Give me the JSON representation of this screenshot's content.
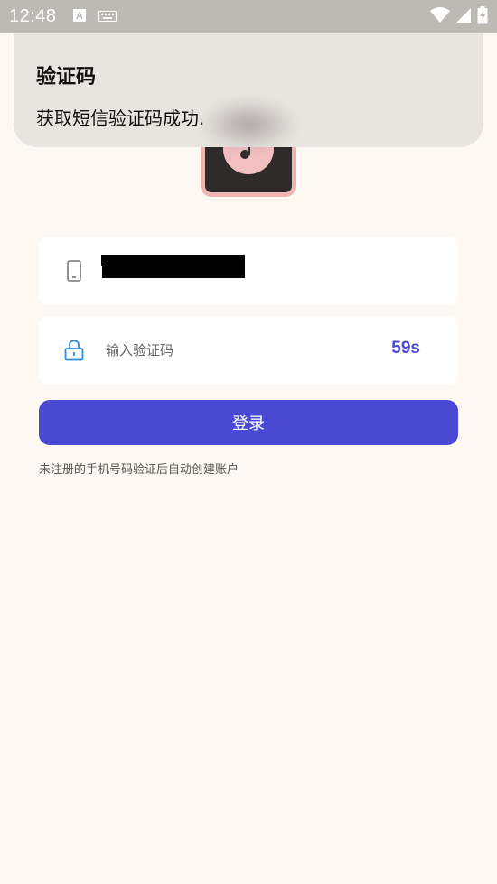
{
  "status_bar": {
    "time": "12:48",
    "icons": [
      "a-icon",
      "keyboard-icon",
      "wifi-icon",
      "signal-icon",
      "battery-charging-icon"
    ]
  },
  "notification": {
    "title": "验证码",
    "message": "获取短信验证码成功."
  },
  "login_form": {
    "phone_icon": "phone-icon",
    "code_placeholder": "输入验证码",
    "code_icon": "lock-icon",
    "countdown": "59s",
    "login_label": "登录",
    "hint": "未注册的手机号码验证后自动创建账户"
  },
  "colors": {
    "background": "#fdf8f2",
    "accent": "#4a49d4",
    "logo_border": "#f0b6b4"
  }
}
